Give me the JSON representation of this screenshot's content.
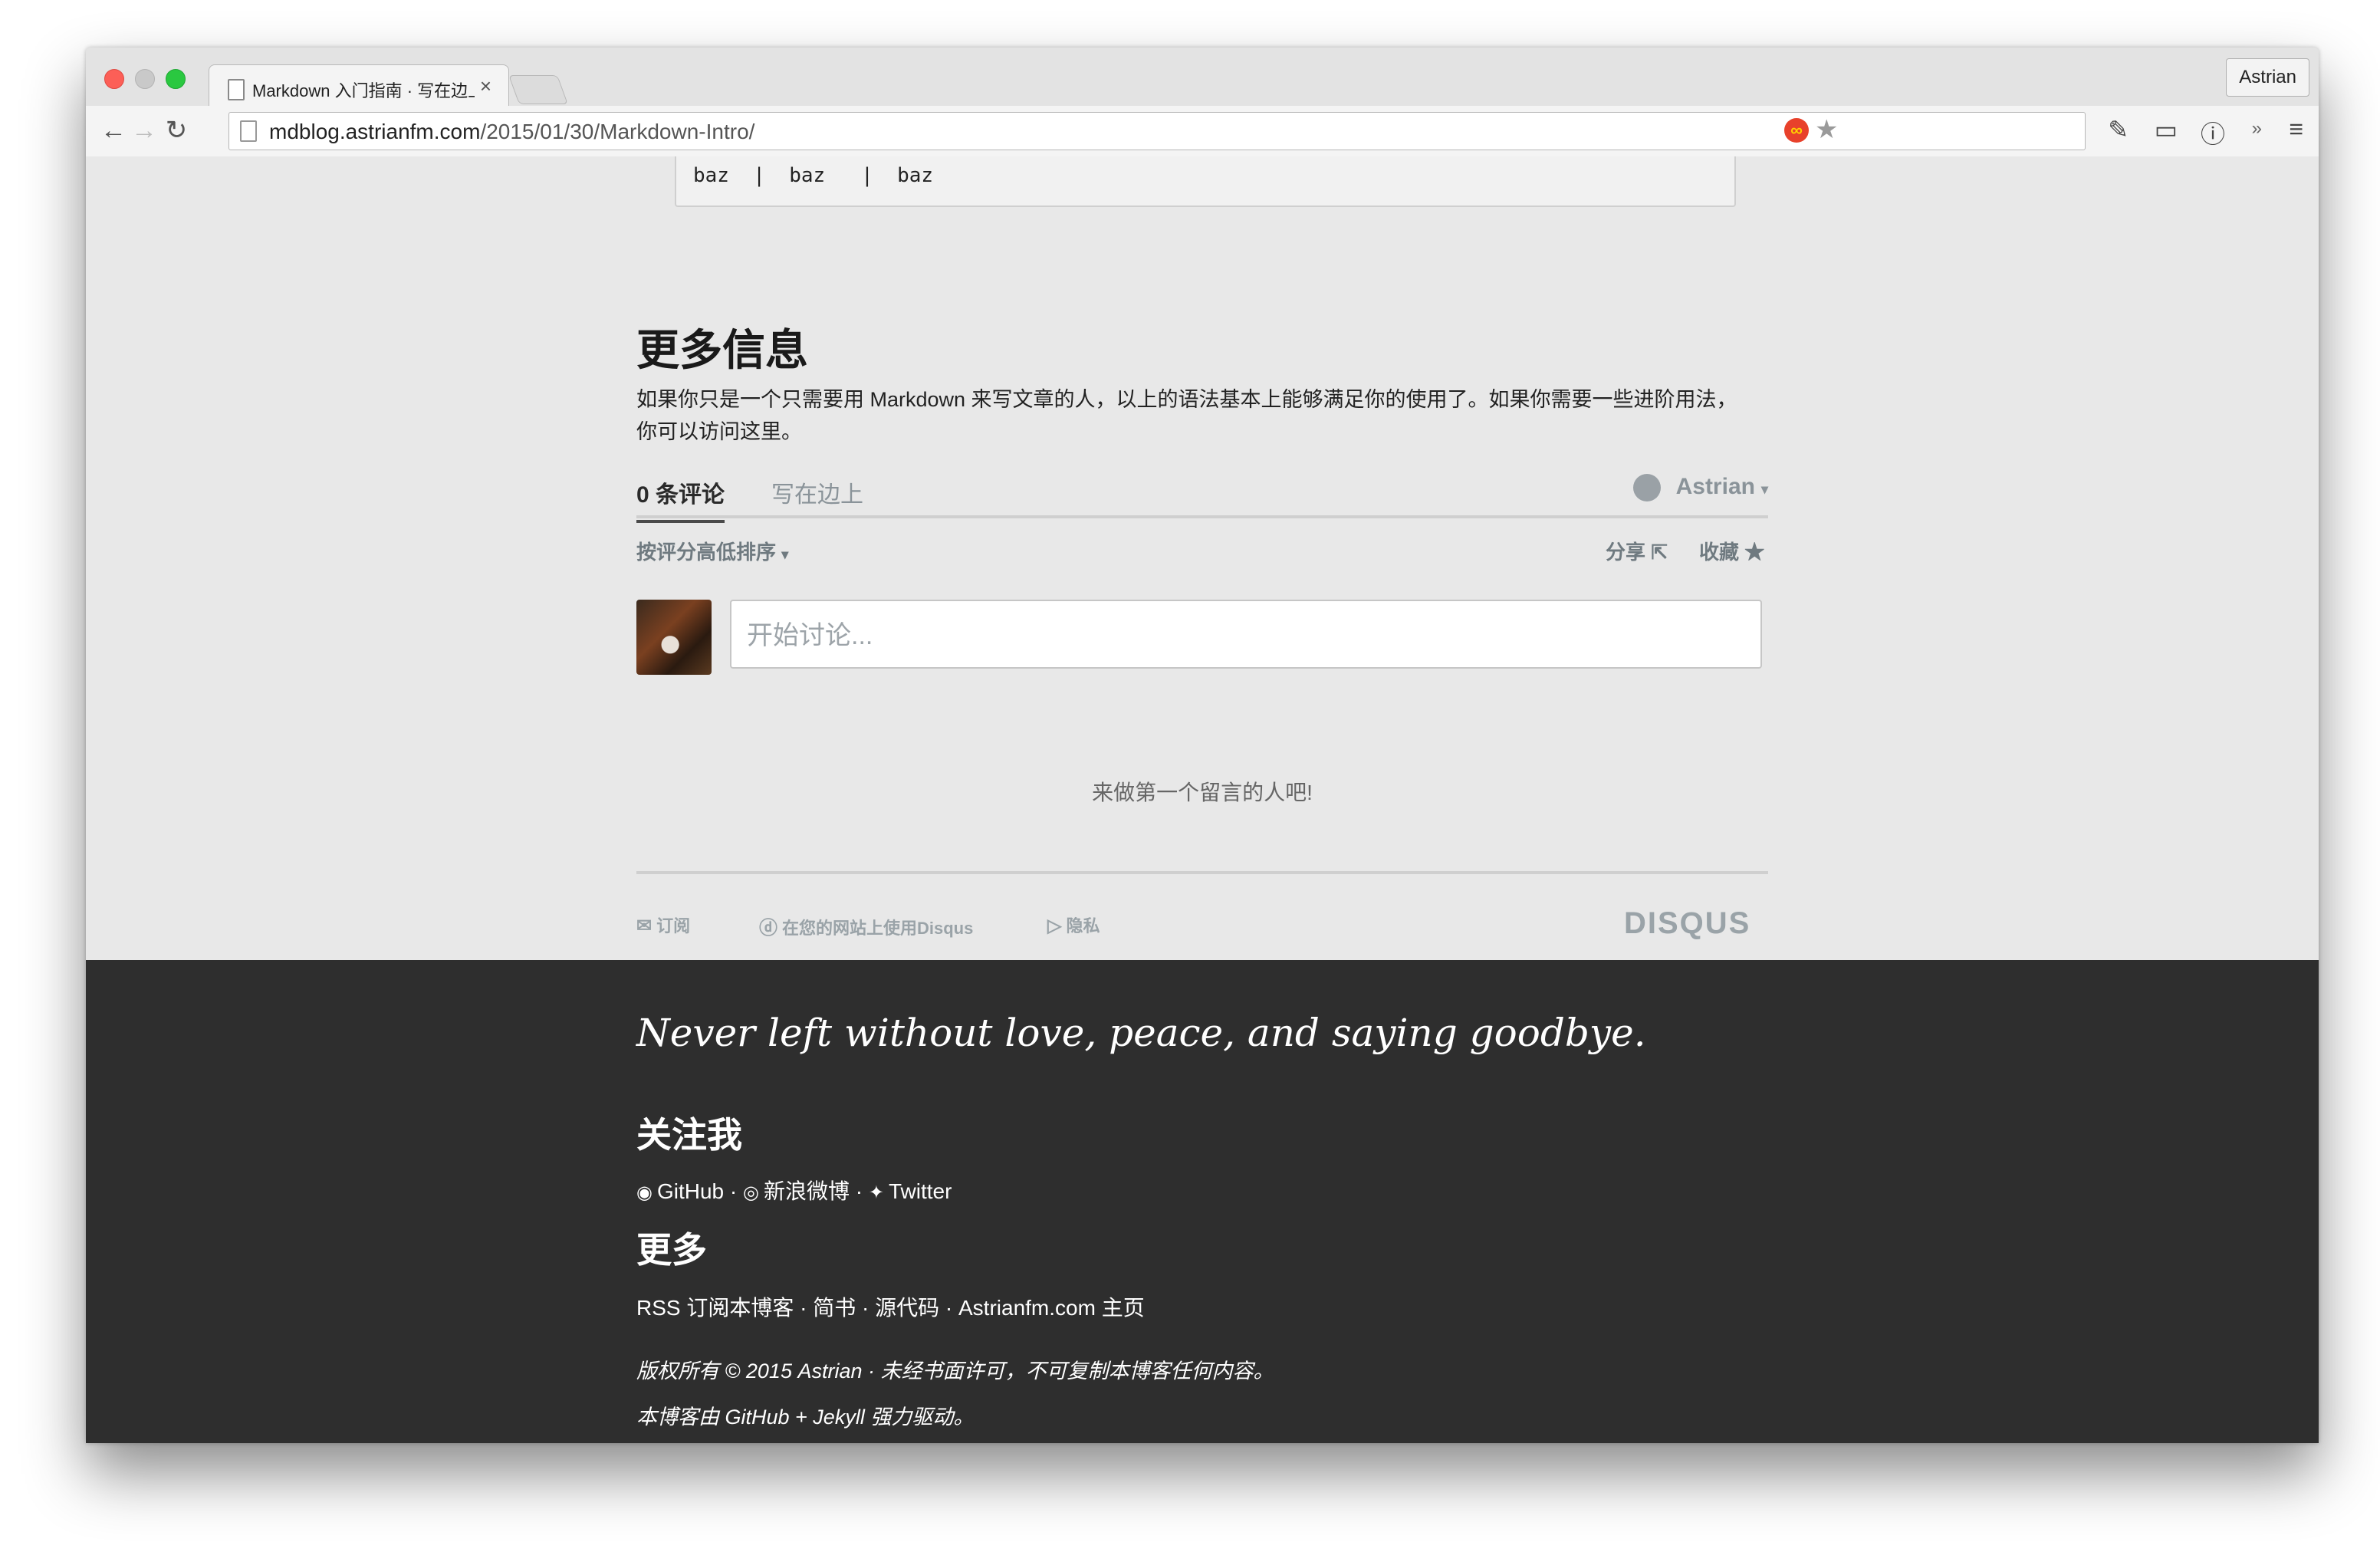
{
  "browser": {
    "tab_title": "Markdown 入门指南 · 写在边上",
    "tab_close": "×",
    "profile": "Astrian",
    "url_host": "mdblog.astrianfm.com",
    "url_path": "/2015/01/30/Markdown-Intro/"
  },
  "icons": {
    "back": "arrow-left-icon",
    "forward": "arrow-right-icon",
    "reload": "reload-icon",
    "star": "star-icon",
    "menu": "hamburger-menu-icon"
  },
  "glyphs": {
    "back": "←",
    "forward": "→",
    "reload": "↻",
    "star": "★",
    "brush": "✎",
    "cast": "▭",
    "info": "ⓘ",
    "more": "»",
    "menu": "≡",
    "ext": "∞",
    "caret": "▾",
    "share_icon": "⇱",
    "fav_icon": "★",
    "mail": "✉",
    "disqus_d": "ⓓ",
    "privacy": "▷",
    "github": "◉",
    "weibo": "◎",
    "twitter": "✦"
  },
  "code": {
    "text": "baz  |  baz   |  baz"
  },
  "article": {
    "heading": "更多信息",
    "paragraph": "如果你只是一个只需要用 Markdown 来写文章的人，以上的语法基本上能够满足你的使用了。如果你需要一些进阶用法，你可以访问这里。"
  },
  "disqus": {
    "tab_count": "0 条评论",
    "tab_site": "写在边上",
    "user": "Astrian",
    "sort": "按评分高低排序",
    "share": "分享",
    "favorite": "收藏",
    "input_placeholder": "开始讨论...",
    "empty": "来做第一个留言的人吧!",
    "subscribe": "订阅",
    "add_disqus": "在您的网站上使用Disqus",
    "privacy": "隐私",
    "logo": "DISQUS"
  },
  "footer": {
    "motto": "Never left without love, peace, and saying goodbye.",
    "follow_heading": "关注我",
    "github": "GitHub",
    "weibo": "新浪微博",
    "twitter": "Twitter",
    "sep": " · ",
    "more_heading": "更多",
    "more_links": "RSS 订阅本博客 · 简书 · 源代码 · Astrianfm.com 主页",
    "copyright": "版权所有 © 2015 Astrian · 未经书面许可，不可复制本博客任何内容。",
    "powered": "本博客由 GitHub + Jekyll 强力驱动。"
  }
}
